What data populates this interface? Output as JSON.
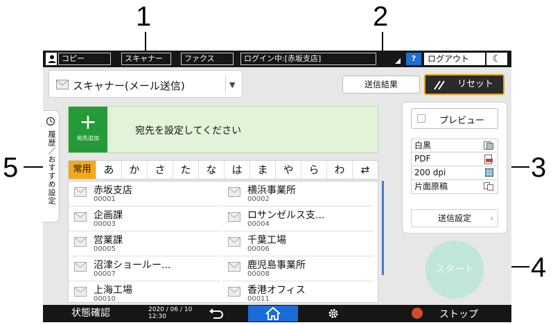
{
  "callouts": [
    "1",
    "2",
    "3",
    "4",
    "5"
  ],
  "topbar": {
    "copy": "コピー",
    "scanner": "スキャナー",
    "fax": "ファクス",
    "login": "ログイン中:[赤坂支店]",
    "help": "?",
    "logout": "ログアウト",
    "moon": "☾"
  },
  "dest_mode": {
    "label": "スキャナー(メール送信)",
    "arrow": "▼"
  },
  "send_result": "送信結果",
  "reset": "リセット",
  "history_tab": "履歴／おすすめ設定",
  "add_dest": {
    "plus": "+",
    "label": "宛先追加",
    "message": "宛先を設定してください"
  },
  "index_tabs": [
    "常用",
    "あ",
    "か",
    "さ",
    "た",
    "な",
    "は",
    "ま",
    "や",
    "ら",
    "わ",
    "⇄"
  ],
  "destinations": [
    {
      "name": "赤坂支店",
      "number": "00001"
    },
    {
      "name": "横浜事業所",
      "number": "00002"
    },
    {
      "name": "企画課",
      "number": "00003"
    },
    {
      "name": "ロサンゼルス支...",
      "number": "00004"
    },
    {
      "name": "営業課",
      "number": "00005"
    },
    {
      "name": "千葉工場",
      "number": "00006"
    },
    {
      "name": "沼津ショールー...",
      "number": "00007"
    },
    {
      "name": "鹿児島事業所",
      "number": "00008"
    },
    {
      "name": "上海工場",
      "number": "00010"
    },
    {
      "name": "香港オフィス",
      "number": "00011"
    }
  ],
  "settings": {
    "preview": "プレビュー",
    "color": "白黒",
    "format": "PDF",
    "resolution": "200 dpi",
    "sides": "片面原稿",
    "send_settings": "送信設定"
  },
  "start": "スタート",
  "bottombar": {
    "status": "状態確認",
    "date": "2020 / 06 / 10",
    "time": "12:30",
    "stop": "ストップ"
  },
  "colors": {
    "accent_orange": "#f2a81b",
    "add_green": "#249a38",
    "home_blue": "#1a6cd9",
    "help_blue": "#1d6fd1",
    "stop_red": "#d84a2c",
    "start_mint": "#bfe6d8"
  }
}
